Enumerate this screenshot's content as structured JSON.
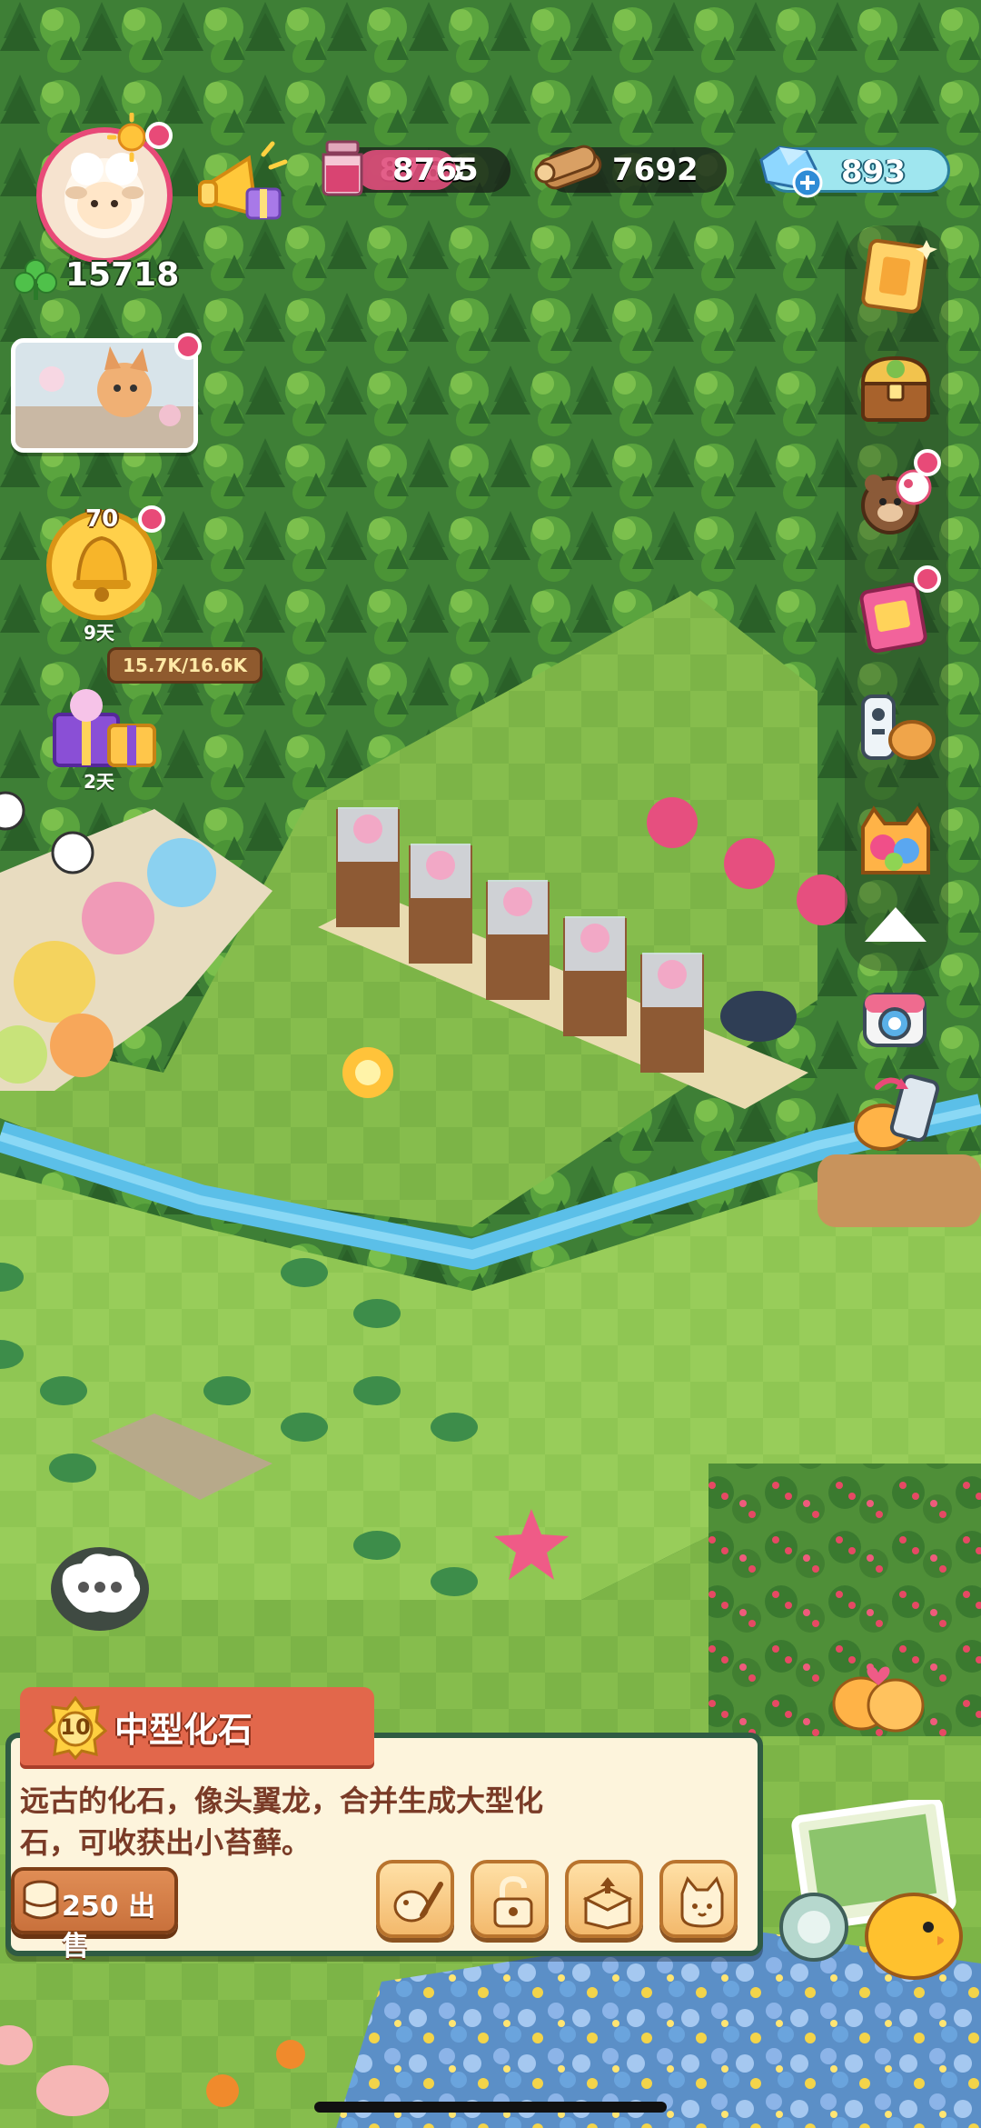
{
  "hud": {
    "player_points": "15718",
    "avatar_level_icon": "sun-icon",
    "event_counter": "70",
    "event_timer": "9天",
    "gift_timer": "2天",
    "orchard_output": "15.7K/16.6K"
  },
  "resources": {
    "potion": "8765",
    "wood": "7692",
    "gems": "893"
  },
  "side_menu": [
    {
      "icon": "quest-book-icon"
    },
    {
      "icon": "treasure-chest-icon"
    },
    {
      "icon": "pets-icon"
    },
    {
      "icon": "recipe-book-icon"
    },
    {
      "icon": "remote-bread-icon"
    },
    {
      "icon": "cat-bag-icon"
    },
    {
      "icon": "collapse-arrow-icon"
    },
    {
      "icon": "camera-icon"
    },
    {
      "icon": "phone-trade-icon"
    }
  ],
  "item_panel": {
    "level": "10",
    "title": "中型化石",
    "description_line1": "远古的化石，像头翼龙，合并生成大型化",
    "description_line2": "石，可收获出小苔藓。",
    "sell_label": "250 出售"
  },
  "colors": {
    "accent_red": "#e84a78",
    "panel_header": "#e2674b",
    "panel_bg": "#fdf4dc",
    "gem_bar": "#9fe6ef",
    "potion_bar": "#e04e7c"
  }
}
